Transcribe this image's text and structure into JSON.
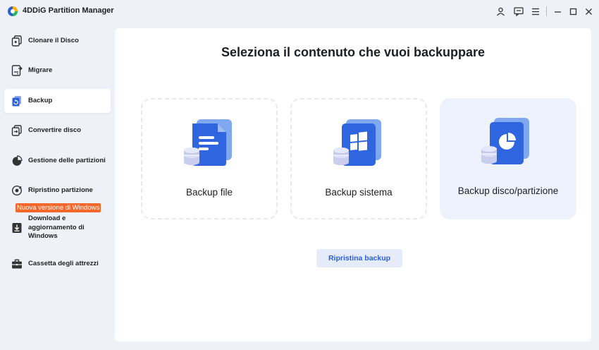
{
  "app": {
    "title": "4DDiG Partition Manager"
  },
  "sidebar": {
    "items": [
      {
        "label": "Clonare il Disco",
        "icon": "clone-disk-icon"
      },
      {
        "label": "Migrare",
        "icon": "migrate-icon"
      },
      {
        "label": "Backup",
        "icon": "backup-icon",
        "active": true
      },
      {
        "label": "Convertire disco",
        "icon": "convert-disk-icon"
      },
      {
        "label": "Gestione delle partizioni",
        "icon": "partition-pie-icon"
      },
      {
        "label": "Ripristino partizione",
        "icon": "partition-recovery-icon"
      },
      {
        "label": "Download e aggiornamento di Windows",
        "icon": "windows-download-icon"
      },
      {
        "label": "Cassetta degli attrezzi",
        "icon": "toolbox-icon"
      }
    ],
    "update_badge": "Nuova versione di Windows"
  },
  "main": {
    "title": "Seleziona il contenuto che vuoi backuppare",
    "cards": [
      {
        "label": "Backup file",
        "icon": "file-backup-icon"
      },
      {
        "label": "Backup sistema",
        "icon": "system-backup-icon"
      },
      {
        "label": "Backup disco/partizione",
        "icon": "disk-partition-backup-icon",
        "selected": true
      }
    ],
    "restore_button": "Ripristina backup"
  },
  "colors": {
    "accent": "#2d5fd6",
    "badge": "#f4692b",
    "background": "#eef1f8"
  }
}
